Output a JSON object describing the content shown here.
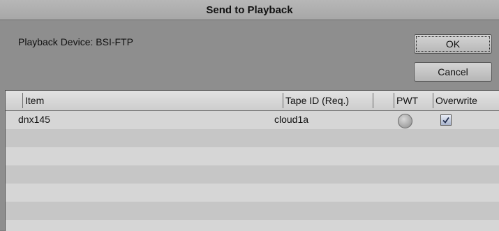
{
  "window": {
    "title": "Send to Playback"
  },
  "device": {
    "label": "Playback Device: BSI-FTP"
  },
  "buttons": {
    "ok": "OK",
    "cancel": "Cancel"
  },
  "table": {
    "columns": [
      "Item",
      "Tape ID (Req.)",
      "PWT",
      "Overwrite"
    ],
    "rows": [
      {
        "item": "dnx145",
        "tape_id": "cloud1a",
        "pwt": false,
        "overwrite": true
      }
    ]
  }
}
